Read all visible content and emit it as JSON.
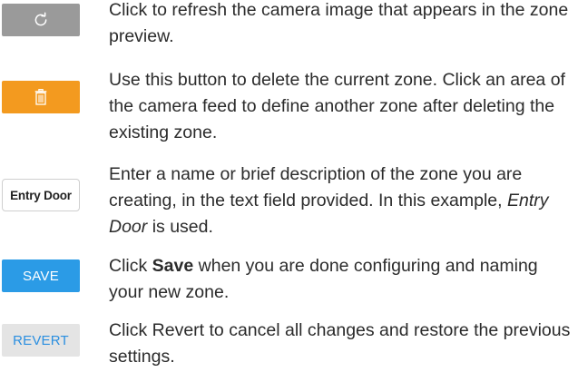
{
  "rows": [
    {
      "button": {
        "icon": "refresh-icon",
        "color": "#9a9a9a"
      },
      "description": "Click to refresh the camera image that appears in the zone preview."
    },
    {
      "button": {
        "icon": "trash-icon",
        "color": "#f39a1f"
      },
      "description": "Use this button to delete the current zone. Click an area of the camera feed to define another zone after deleting the existing zone."
    },
    {
      "button": {
        "label": "Entry Door",
        "color": "#ffffff"
      },
      "description_pre": "Enter a name or brief description of the zone you are creating, in the text field provided. In this example, ",
      "description_em": "Entry Door",
      "description_post": " is used."
    },
    {
      "button": {
        "label": "SAVE",
        "color": "#2b9be6"
      },
      "description_pre": "Click ",
      "description_strong": "Save",
      "description_post": " when you are done configuring and naming your new zone."
    },
    {
      "button": {
        "label": "REVERT",
        "color": "#e4e4e4",
        "text_color": "#2b8fe0"
      },
      "description": "Click Revert to cancel all changes and restore the previous settings."
    }
  ]
}
